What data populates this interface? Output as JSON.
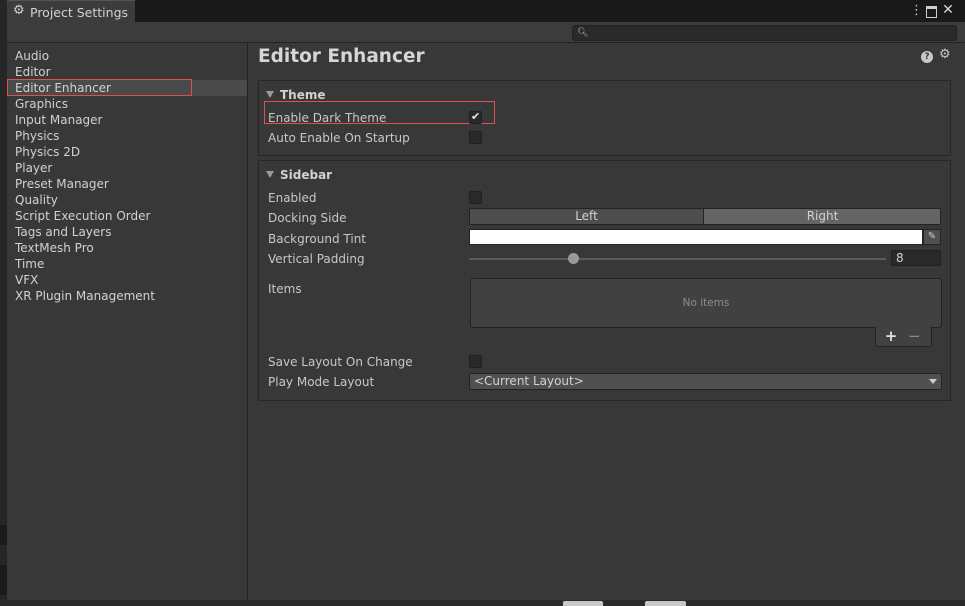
{
  "window": {
    "title": "Project Settings",
    "menu_glyph": "⋮",
    "close_glyph": "✕"
  },
  "search": {
    "placeholder": "",
    "value": ""
  },
  "sidebar": {
    "items": [
      {
        "label": "Audio",
        "selected": false
      },
      {
        "label": "Editor",
        "selected": false
      },
      {
        "label": "Editor Enhancer",
        "selected": true
      },
      {
        "label": "Graphics",
        "selected": false
      },
      {
        "label": "Input Manager",
        "selected": false
      },
      {
        "label": "Physics",
        "selected": false
      },
      {
        "label": "Physics 2D",
        "selected": false
      },
      {
        "label": "Player",
        "selected": false
      },
      {
        "label": "Preset Manager",
        "selected": false
      },
      {
        "label": "Quality",
        "selected": false
      },
      {
        "label": "Script Execution Order",
        "selected": false
      },
      {
        "label": "Tags and Layers",
        "selected": false
      },
      {
        "label": "TextMesh Pro",
        "selected": false
      },
      {
        "label": "Time",
        "selected": false
      },
      {
        "label": "VFX",
        "selected": false
      },
      {
        "label": "XR Plugin Management",
        "selected": false
      }
    ]
  },
  "main": {
    "title": "Editor Enhancer",
    "help_glyph": "?",
    "theme": {
      "header": "Theme",
      "enable_dark_theme": {
        "label": "Enable Dark Theme",
        "checked": true
      },
      "auto_enable": {
        "label": "Auto Enable On Startup",
        "checked": false
      }
    },
    "sidebar_section": {
      "header": "Sidebar",
      "enabled": {
        "label": "Enabled",
        "checked": false
      },
      "docking_side": {
        "label": "Docking Side",
        "options": [
          "Left",
          "Right"
        ],
        "selected": "Right"
      },
      "background_tint": {
        "label": "Background Tint",
        "color": "#ffffff"
      },
      "vertical_padding": {
        "label": "Vertical Padding",
        "value": "8",
        "slider_fraction": 0.25
      },
      "items": {
        "label": "Items",
        "empty_text": "No items",
        "add_glyph": "+",
        "remove_glyph": "−"
      },
      "save_layout": {
        "label": "Save Layout On Change",
        "checked": false
      },
      "play_mode_layout": {
        "label": "Play Mode Layout",
        "value": "<Current Layout>"
      }
    }
  },
  "colors": {
    "panel_bg": "#383838",
    "highlight_outline": "#e05050",
    "selection_bg": "#4a4a4a"
  }
}
